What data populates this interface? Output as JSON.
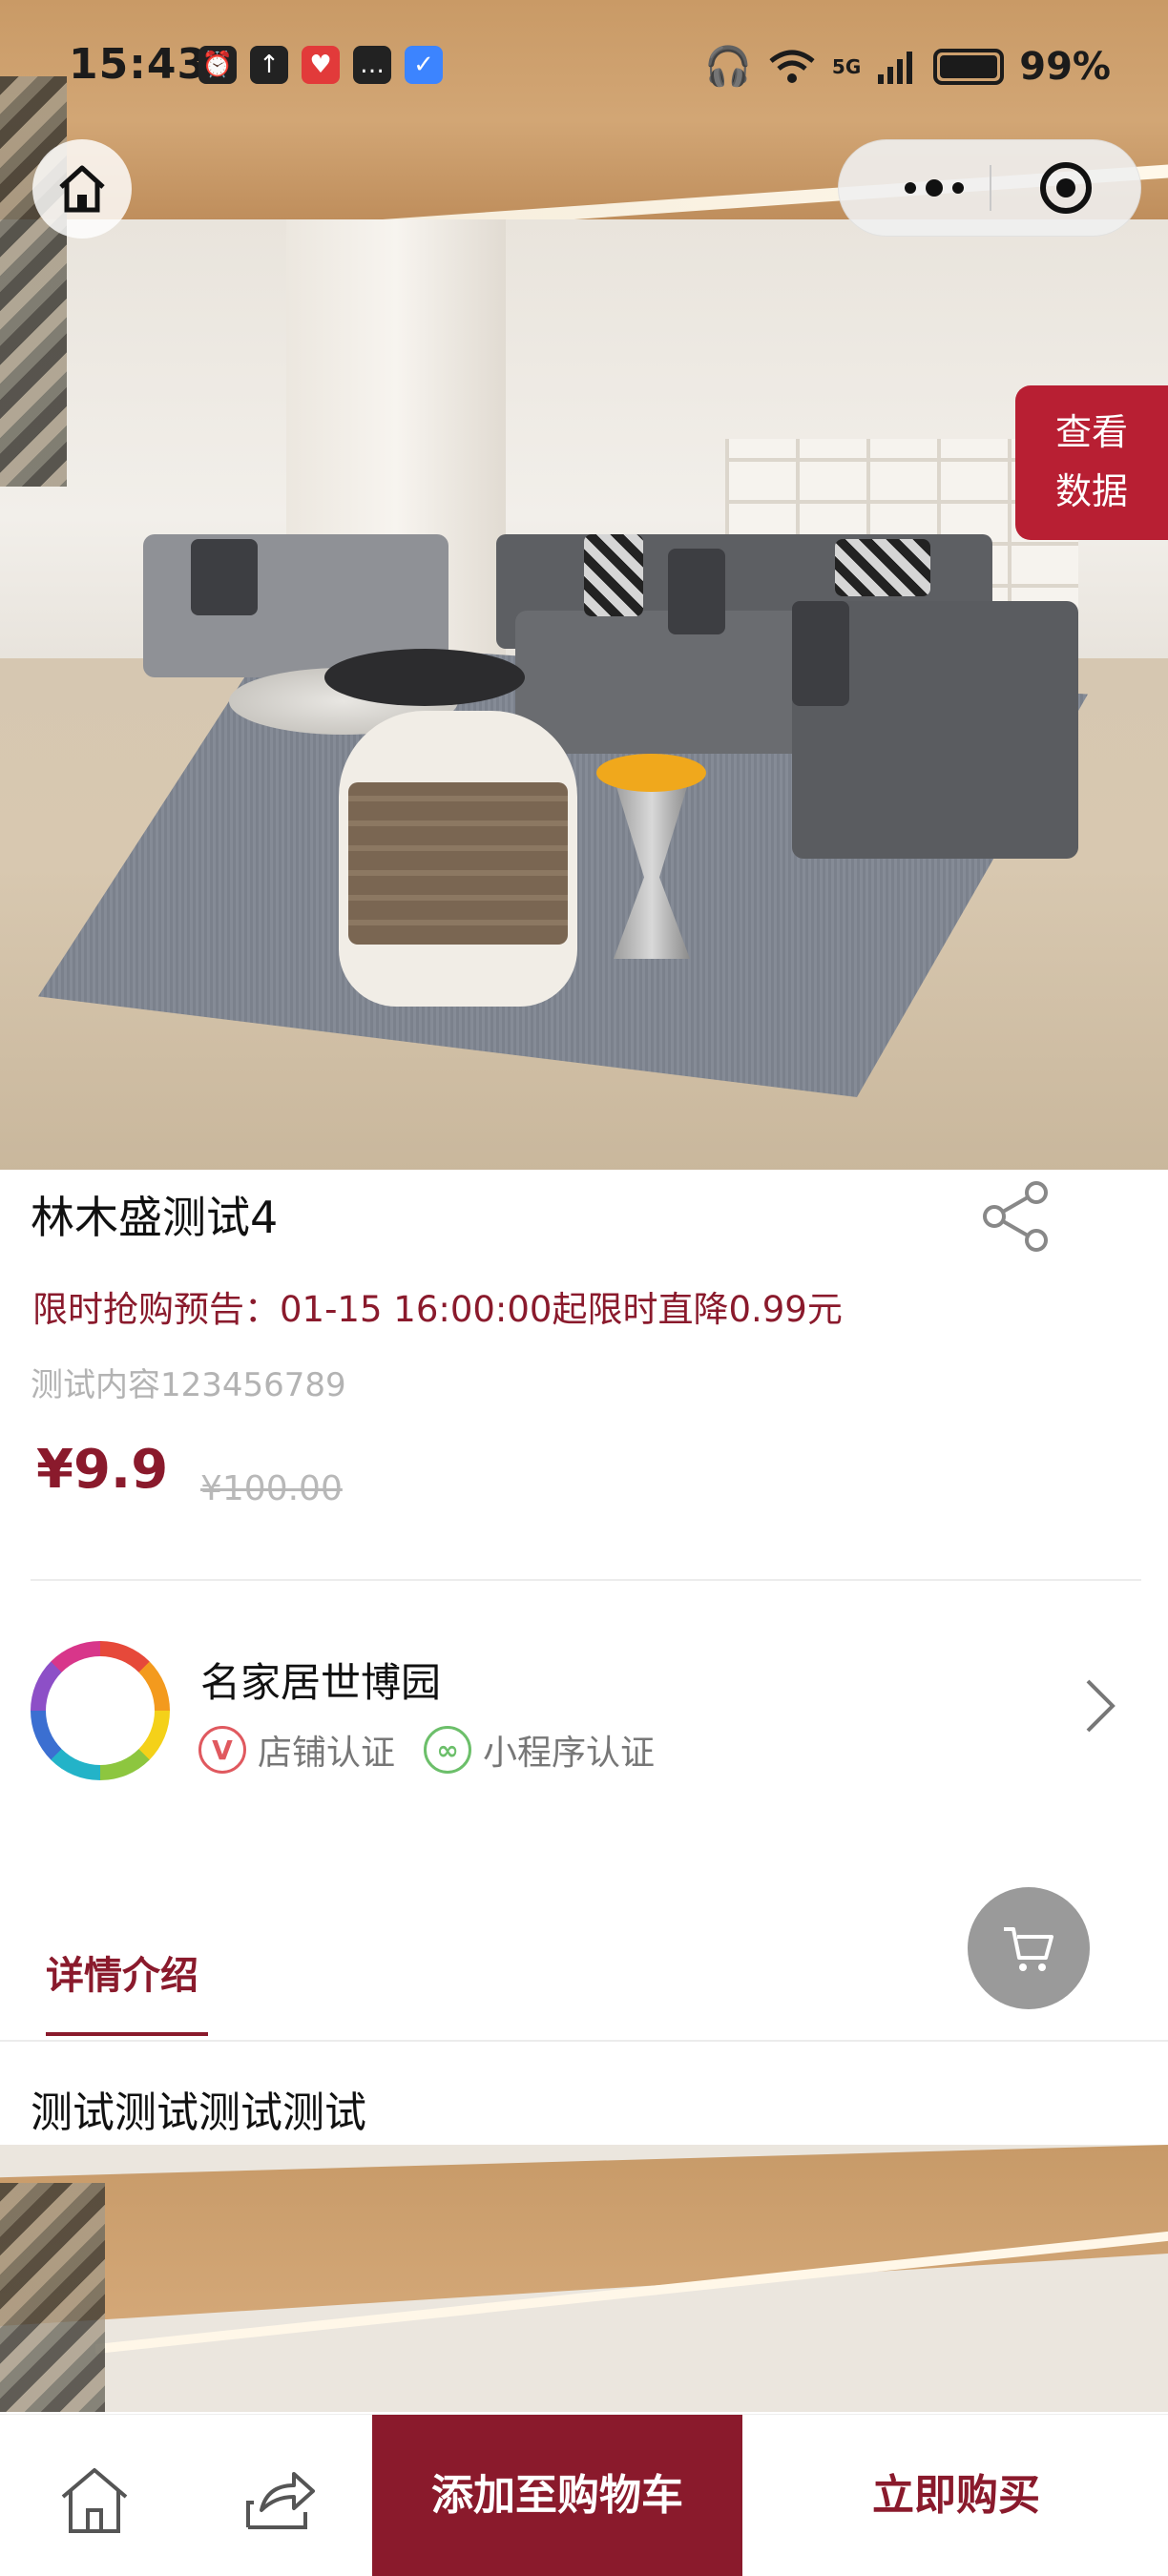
{
  "status_bar": {
    "time": "15:43",
    "network": "5G",
    "battery": "99%",
    "notification_icons": [
      "alarm-icon",
      "upload-icon",
      "app-icon",
      "message-icon",
      "shield-icon"
    ]
  },
  "capsule": {
    "more_icon": "more-dots-icon",
    "close_icon": "close-target-icon"
  },
  "home_icon": "home-icon",
  "view_data": {
    "line1": "查看",
    "line2": "数据"
  },
  "product": {
    "title": "林木盛测试4",
    "promo": "限时抢购预告：01-15 16:00:00起限时直降0.99元",
    "description": "测试内容123456789",
    "price": "¥9.9",
    "original_price": "¥100.00",
    "share_icon": "share-icon"
  },
  "store": {
    "name": "名家居世博园",
    "badge_shop": "店铺认证",
    "badge_miniprogram": "小程序认证",
    "badge_shop_glyph": "V",
    "badge_mini_glyph": "∞"
  },
  "details": {
    "tab_label": "详情介绍",
    "text": "测试测试测试测试"
  },
  "bottom_bar": {
    "add_to_cart": "添加至购物车",
    "buy_now": "立即购买"
  },
  "colors": {
    "brand": "#8a1a2c",
    "view_data_bg": "#b81f33",
    "cart_float_bg": "#9a9a9a"
  }
}
